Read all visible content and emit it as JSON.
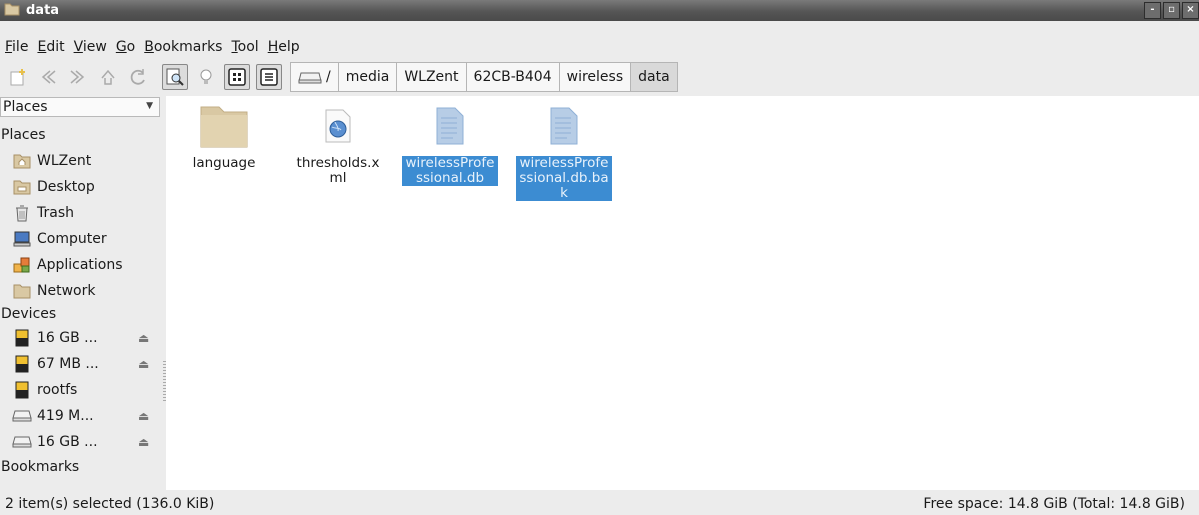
{
  "window": {
    "title": "data",
    "buttons": [
      "-",
      "▫",
      "×"
    ]
  },
  "menu": [
    {
      "label": "File",
      "mnemonic": "F",
      "rest": "ile"
    },
    {
      "label": "Edit",
      "mnemonic": "E",
      "rest": "dit"
    },
    {
      "label": "View",
      "mnemonic": "V",
      "rest": "iew"
    },
    {
      "label": "Go",
      "mnemonic": "G",
      "rest": "o"
    },
    {
      "label": "Bookmarks",
      "mnemonic": "B",
      "rest": "ookmarks"
    },
    {
      "label": "Tool",
      "mnemonic": "T",
      "rest": "ool"
    },
    {
      "label": "Help",
      "mnemonic": "H",
      "rest": "elp"
    }
  ],
  "path": {
    "root_label": "/",
    "segments": [
      "media",
      "WLZent",
      "62CB-B404",
      "wireless",
      "data"
    ]
  },
  "sidebar": {
    "selector": "Places",
    "places_header": "Places",
    "places": [
      {
        "label": "WLZent",
        "icon": "home-folder-icon"
      },
      {
        "label": "Desktop",
        "icon": "desktop-folder-icon"
      },
      {
        "label": "Trash",
        "icon": "trash-icon"
      },
      {
        "label": "Computer",
        "icon": "computer-icon"
      },
      {
        "label": "Applications",
        "icon": "applications-icon"
      },
      {
        "label": "Network",
        "icon": "network-folder-icon"
      }
    ],
    "devices_header": "Devices",
    "devices": [
      {
        "label": "16 GB ...",
        "eject": "⏏"
      },
      {
        "label": "67 MB ...",
        "eject": "⏏"
      },
      {
        "label": "rootfs",
        "eject": ""
      },
      {
        "label": "419 M...",
        "eject": "⏏"
      },
      {
        "label": "16 GB ...",
        "eject": "⏏"
      }
    ],
    "bookmarks_header": "Bookmarks"
  },
  "files": [
    {
      "name": "language",
      "type": "folder",
      "selected": false
    },
    {
      "name": "thresholds.xml",
      "type": "xml",
      "selected": false
    },
    {
      "name": "wirelessProfessional.db",
      "type": "document",
      "selected": true
    },
    {
      "name": "wirelessProfessional.db.bak",
      "type": "document",
      "selected": true
    }
  ],
  "status": {
    "selection": "2 item(s) selected (136.0 KiB)",
    "free_space": "Free space: 14.8 GiB (Total: 14.8 GiB)"
  },
  "colors": {
    "selection": "#3c8cd2",
    "folder": "#d9c8a3"
  }
}
